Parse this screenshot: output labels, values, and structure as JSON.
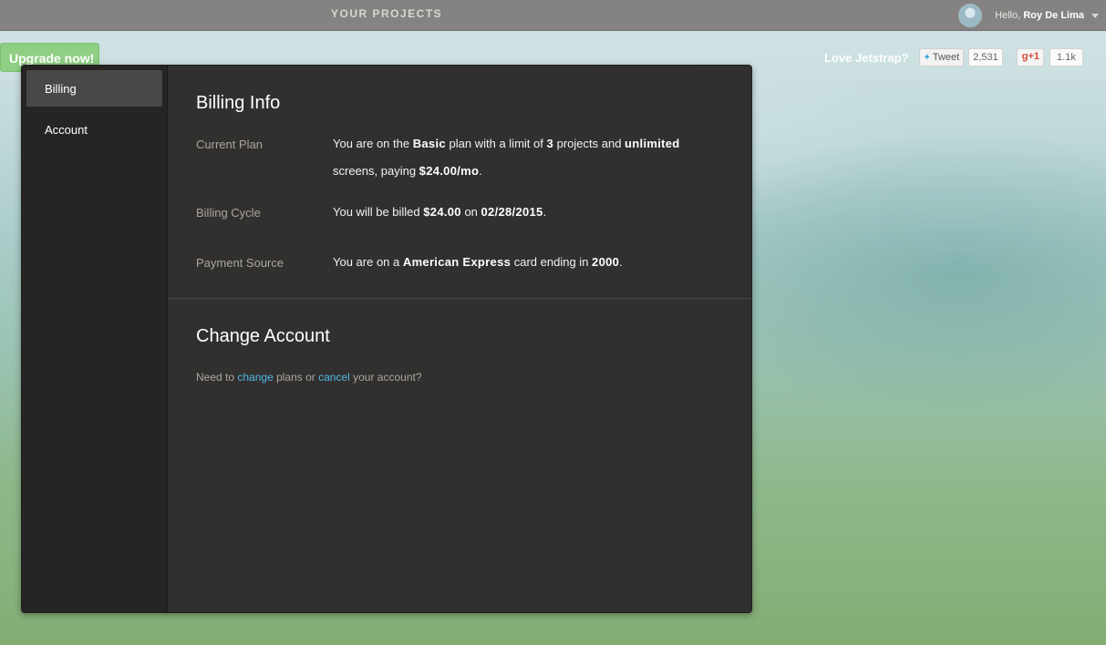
{
  "topbar": {
    "projects_label": "YOUR PROJECTS",
    "greeting": "Hello,",
    "user_name": "Roy De Lima"
  },
  "subbar": {
    "upgrade_label": "Upgrade now!",
    "love_text": "Love Jetstrap?",
    "tweet_label": "Tweet",
    "tweet_count": "2,531",
    "gplus_label": "+1",
    "gplus_count": "1.1k"
  },
  "sidebar": {
    "items": [
      {
        "label": "Billing",
        "active": true
      },
      {
        "label": "Account",
        "active": false
      }
    ]
  },
  "billing": {
    "title": "Billing Info",
    "current_plan": {
      "label": "Current Plan",
      "t1": "You are on the ",
      "plan": "Basic",
      "t2": " plan with a limit of ",
      "limit": "3",
      "t3": " projects and ",
      "screens": "unlimited",
      "t4": " screens, paying ",
      "price": "$24.00/mo",
      "t5": "."
    },
    "billing_cycle": {
      "label": "Billing Cycle",
      "t1": "You will be billed ",
      "amount": "$24.00",
      "t2": " on ",
      "date": "02/28/2015",
      "t3": "."
    },
    "payment_source": {
      "label": "Payment Source",
      "t1": "You are on a ",
      "card": "American Express",
      "t2": " card ending in ",
      "last4": "2000",
      "t3": "."
    }
  },
  "change_account": {
    "title": "Change Account",
    "t1": "Need to ",
    "change_link": "change",
    "t2": " plans or ",
    "cancel_link": "cancel",
    "t3": " your account?"
  },
  "colors": {
    "topbar": "#858381",
    "upgrade": "#8fcf84",
    "panel": "#32302e",
    "sidebar": "#262524",
    "link": "#4fb7e6"
  }
}
